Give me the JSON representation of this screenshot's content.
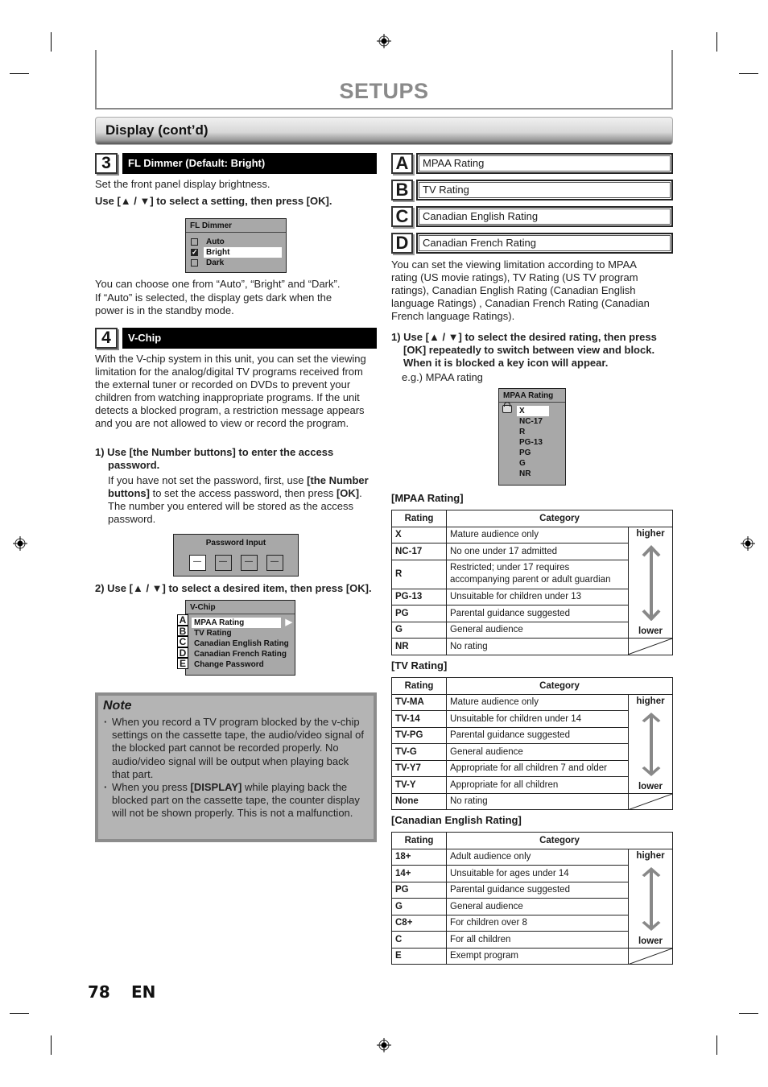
{
  "header": {
    "title": "SETUPS",
    "section": "Display (cont’d)"
  },
  "step3": {
    "number": "3",
    "label": "FL Dimmer (Default: Bright)",
    "desc": "Set the front panel display brightness.",
    "instruction": "Use [▲ / ▼] to select a setting, then press [OK].",
    "osd": {
      "title": "FL Dimmer",
      "options": [
        {
          "label": "Auto",
          "checked": false
        },
        {
          "label": "Bright",
          "checked": true
        },
        {
          "label": "Dark",
          "checked": false
        }
      ]
    },
    "after_1": "You can choose one from “Auto”, “Bright” and “Dark”.",
    "after_2": "If “Auto” is selected, the display gets dark when the power is in the standby mode."
  },
  "step4": {
    "number": "4",
    "label": "V-Chip",
    "intro": "With the V-chip system in this unit, you can set the viewing limitation for the analog/digital TV programs received from the external tuner or recorded on DVDs to prevent your children from watching inappropriate programs. If the unit detects a blocked program, a restriction message appears and you are not allowed to view or record the program.",
    "sub1_heading": "1) Use [the Number buttons] to enter the access password.",
    "sub1_body_a": "If you have not set the password, first, use ",
    "sub1_body_b": "[the Number buttons]",
    "sub1_body_c": " to set the access password, then press ",
    "sub1_body_d": "[OK]",
    "sub1_body_e": ". The number you entered will be stored as the access password.",
    "password_osd": {
      "title": "Password Input",
      "slots": [
        "—",
        "—",
        "—",
        "—"
      ]
    },
    "sub2_heading": "2) Use [▲ / ▼] to select a desired item, then press [OK].",
    "vchip_osd": {
      "title": "V-Chip",
      "items": [
        {
          "letter": "A",
          "label": "MPAA Rating"
        },
        {
          "letter": "B",
          "label": "TV Rating"
        },
        {
          "letter": "C",
          "label": "Canadian English Rating"
        },
        {
          "letter": "D",
          "label": "Canadian French Rating"
        },
        {
          "letter": "E",
          "label": "Change Password"
        }
      ]
    }
  },
  "note": {
    "title": "Note",
    "item1": "When you record a TV program blocked by the v-chip settings on the cassette tape, the audio/video signal of the blocked part cannot be recorded properly. No audio/video signal will be output when playing back that part.",
    "item2_a": "When you press ",
    "item2_b": "[DISPLAY]",
    "item2_c": " while playing back the blocked part on the cassette tape, the counter display will not be shown properly. This is not a malfunction."
  },
  "right": {
    "options": [
      {
        "letter": "A",
        "label": "MPAA Rating"
      },
      {
        "letter": "B",
        "label": "TV Rating"
      },
      {
        "letter": "C",
        "label": "Canadian English Rating"
      },
      {
        "letter": "D",
        "label": "Canadian French Rating"
      }
    ],
    "desc": "You can set the viewing limitation according to MPAA rating (US movie ratings), TV Rating (US TV program ratings), Canadian English Rating (Canadian English language Ratings) , Canadian French Rating (Canadian French language Ratings).",
    "step1": "1) Use [▲ / ▼] to select the desired rating, then press [OK] repeatedly to switch between view and block. When it is blocked a key icon will appear.",
    "eg": "e.g.) MPAA rating",
    "mpaa_osd": {
      "title": "MPAA Rating",
      "items": [
        "X",
        "NC-17",
        "R",
        "PG-13",
        "PG",
        "G",
        "NR"
      ],
      "locked": "X"
    }
  },
  "tables": {
    "col_rating": "Rating",
    "col_category": "Category",
    "higher": "higher",
    "lower": "lower",
    "mpaa": {
      "title": "[MPAA Rating]",
      "rows": [
        {
          "rating": "X",
          "category": "Mature audience only"
        },
        {
          "rating": "NC-17",
          "category": "No one under 17 admitted"
        },
        {
          "rating": "R",
          "category": "Restricted; under 17 requires accompanying parent or adult guardian"
        },
        {
          "rating": "PG-13",
          "category": "Unsuitable for children under 13"
        },
        {
          "rating": "PG",
          "category": "Parental guidance suggested"
        },
        {
          "rating": "G",
          "category": "General audience"
        },
        {
          "rating": "NR",
          "category": "No rating"
        }
      ]
    },
    "tv": {
      "title": "[TV Rating]",
      "rows": [
        {
          "rating": "TV-MA",
          "category": "Mature audience only"
        },
        {
          "rating": "TV-14",
          "category": "Unsuitable for children under 14"
        },
        {
          "rating": "TV-PG",
          "category": "Parental guidance suggested"
        },
        {
          "rating": "TV-G",
          "category": "General audience"
        },
        {
          "rating": "TV-Y7",
          "category": "Appropriate for all children 7 and older"
        },
        {
          "rating": "TV-Y",
          "category": "Appropriate for all children"
        },
        {
          "rating": "None",
          "category": "No rating"
        }
      ]
    },
    "canadian_english": {
      "title": "[Canadian English Rating]",
      "rows": [
        {
          "rating": "18+",
          "category": "Adult audience only"
        },
        {
          "rating": "14+",
          "category": "Unsuitable for ages under 14"
        },
        {
          "rating": "PG",
          "category": "Parental guidance suggested"
        },
        {
          "rating": "G",
          "category": "General audience"
        },
        {
          "rating": "C8+",
          "category": "For children over 8"
        },
        {
          "rating": "C",
          "category": "For all children"
        },
        {
          "rating": "E",
          "category": "Exempt program"
        }
      ]
    }
  },
  "footer": {
    "page": "78",
    "lang": "EN"
  }
}
